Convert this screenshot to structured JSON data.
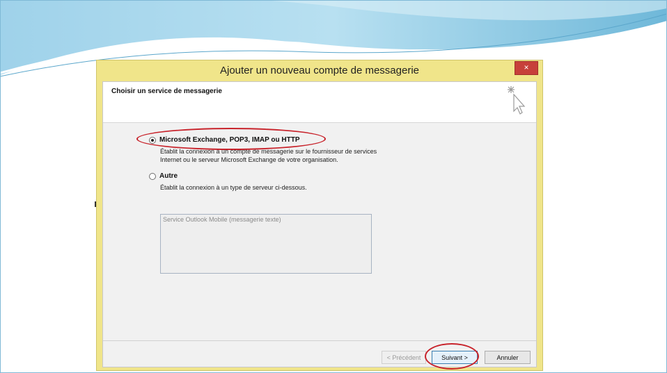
{
  "window": {
    "title": "Ajouter un nouveau compte de messagerie",
    "close_label": "×"
  },
  "header": {
    "title": "Choisir un service de messagerie"
  },
  "options": [
    {
      "label": "Microsoft Exchange, POP3, IMAP ou HTTP",
      "description_line1": "Établit la connexion à un compte de messagerie sur le fournisseur de services",
      "description_line2": "Internet ou le serveur Microsoft Exchange de votre organisation.",
      "selected": true
    },
    {
      "label": "Autre",
      "description_line1": "Établit la connexion à un type de serveur ci-dessous.",
      "selected": false
    }
  ],
  "server_list": {
    "items": [
      "Service Outlook Mobile (messagerie texte)"
    ]
  },
  "buttons": {
    "previous": "< Précédent",
    "next": "Suivant >",
    "cancel": "Annuler"
  },
  "colors": {
    "accent_border": "#f0e58a",
    "annotation_red": "#c8232b",
    "banner_blue": "#7fbfdc"
  }
}
